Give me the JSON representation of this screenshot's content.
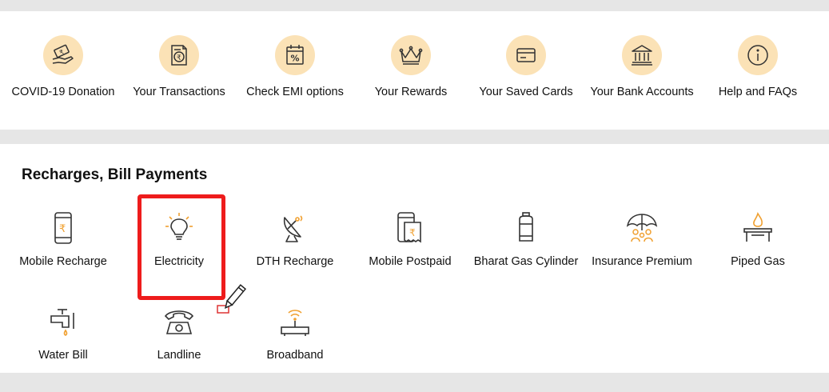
{
  "shortcuts": [
    {
      "label": "COVID-19 Donation",
      "icon": "donation-icon"
    },
    {
      "label": "Your Transactions",
      "icon": "transactions-icon"
    },
    {
      "label": "Check EMI options",
      "icon": "emi-calendar-icon"
    },
    {
      "label": "Your Rewards",
      "icon": "crown-icon"
    },
    {
      "label": "Your Saved Cards",
      "icon": "card-icon"
    },
    {
      "label": "Your Bank Accounts",
      "icon": "bank-icon"
    },
    {
      "label": "Help and FAQs",
      "icon": "info-icon"
    }
  ],
  "bill_payments": {
    "title": "Recharges, Bill Payments",
    "items": [
      {
        "label": "Mobile Recharge",
        "icon": "mobile-rupee-icon"
      },
      {
        "label": "Electricity",
        "icon": "bulb-icon"
      },
      {
        "label": "DTH Recharge",
        "icon": "satellite-dish-icon"
      },
      {
        "label": "Mobile Postpaid",
        "icon": "postpaid-bill-icon"
      },
      {
        "label": "Bharat Gas Cylinder",
        "icon": "gas-cylinder-icon"
      },
      {
        "label": "Insurance Premium",
        "icon": "umbrella-family-icon"
      },
      {
        "label": "Piped Gas",
        "icon": "gas-flame-icon"
      },
      {
        "label": "Water Bill",
        "icon": "water-tap-icon"
      },
      {
        "label": "Landline",
        "icon": "telephone-icon"
      },
      {
        "label": "Broadband",
        "icon": "router-wifi-icon"
      }
    ]
  },
  "colors": {
    "icon_circle": "#fbe2b6",
    "highlight": "#ee1c1c",
    "accent_orange": "#f0a030",
    "page_background": "#e6e6e6"
  }
}
